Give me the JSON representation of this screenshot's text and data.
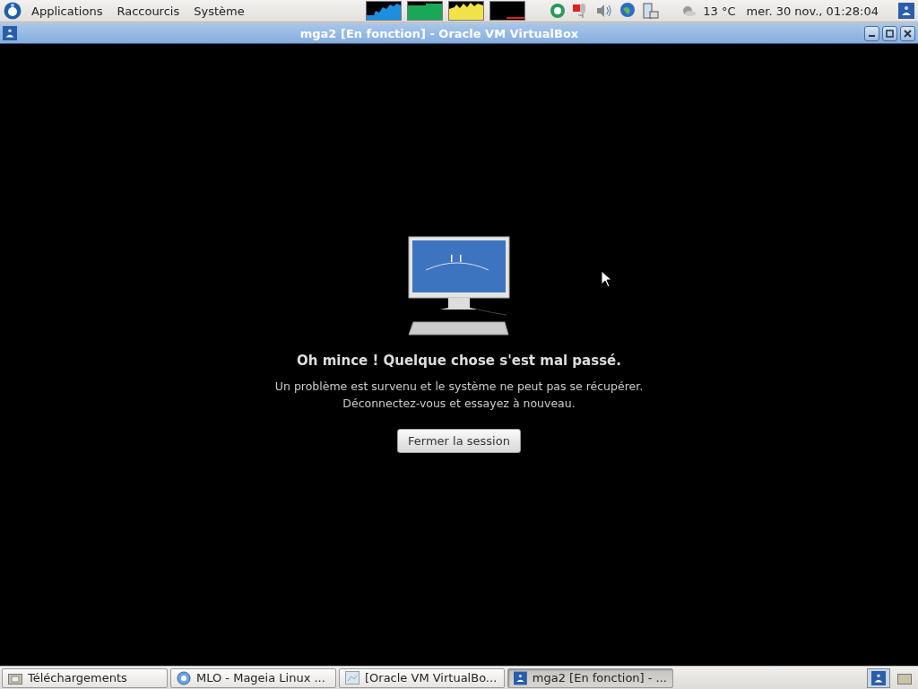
{
  "top_panel": {
    "menus": [
      "Applications",
      "Raccourcis",
      "Système"
    ],
    "weather": "13 °C",
    "clock": "mer. 30 nov., 01:28:04"
  },
  "window": {
    "title": "mga2 [En fonction] - Oracle VM VirtualBox"
  },
  "error_screen": {
    "heading": "Oh mince ! Quelque chose s'est mal passé.",
    "message": [
      "Un problème est survenu et le système ne peut pas se récupérer.",
      "Déconnectez-vous et essayez à nouveau."
    ],
    "button": "Fermer la session"
  },
  "taskbar": {
    "items": [
      {
        "kind": "folder",
        "label": "Téléchargements",
        "selected": false
      },
      {
        "kind": "browser",
        "label": "MLO - Mageia Linux ...",
        "selected": false
      },
      {
        "kind": "window",
        "label": "[Oracle VM VirtualBo...",
        "selected": false
      },
      {
        "kind": "vbox",
        "label": "mga2 [En fonction] - ...",
        "selected": true
      }
    ]
  }
}
